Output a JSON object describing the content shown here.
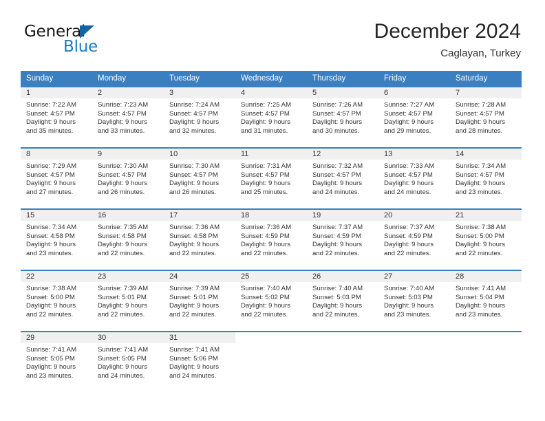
{
  "brand": {
    "name_primary": "General",
    "name_secondary": "Blue",
    "triangle_color": "#1464a5",
    "secondary_color": "#1d7ac4"
  },
  "header": {
    "month_title": "December 2024",
    "location": "Caglayan, Turkey"
  },
  "theme": {
    "header_blue": "#3a7fc1",
    "daynum_band": "#f0f0f0",
    "text": "#333333"
  },
  "calendar": {
    "weekday_headers": [
      "Sunday",
      "Monday",
      "Tuesday",
      "Wednesday",
      "Thursday",
      "Friday",
      "Saturday"
    ],
    "weeks": [
      [
        {
          "day": "1",
          "sunrise": "Sunrise: 7:22 AM",
          "sunset": "Sunset: 4:57 PM",
          "daylight_1": "Daylight: 9 hours",
          "daylight_2": "and 35 minutes."
        },
        {
          "day": "2",
          "sunrise": "Sunrise: 7:23 AM",
          "sunset": "Sunset: 4:57 PM",
          "daylight_1": "Daylight: 9 hours",
          "daylight_2": "and 33 minutes."
        },
        {
          "day": "3",
          "sunrise": "Sunrise: 7:24 AM",
          "sunset": "Sunset: 4:57 PM",
          "daylight_1": "Daylight: 9 hours",
          "daylight_2": "and 32 minutes."
        },
        {
          "day": "4",
          "sunrise": "Sunrise: 7:25 AM",
          "sunset": "Sunset: 4:57 PM",
          "daylight_1": "Daylight: 9 hours",
          "daylight_2": "and 31 minutes."
        },
        {
          "day": "5",
          "sunrise": "Sunrise: 7:26 AM",
          "sunset": "Sunset: 4:57 PM",
          "daylight_1": "Daylight: 9 hours",
          "daylight_2": "and 30 minutes."
        },
        {
          "day": "6",
          "sunrise": "Sunrise: 7:27 AM",
          "sunset": "Sunset: 4:57 PM",
          "daylight_1": "Daylight: 9 hours",
          "daylight_2": "and 29 minutes."
        },
        {
          "day": "7",
          "sunrise": "Sunrise: 7:28 AM",
          "sunset": "Sunset: 4:57 PM",
          "daylight_1": "Daylight: 9 hours",
          "daylight_2": "and 28 minutes."
        }
      ],
      [
        {
          "day": "8",
          "sunrise": "Sunrise: 7:29 AM",
          "sunset": "Sunset: 4:57 PM",
          "daylight_1": "Daylight: 9 hours",
          "daylight_2": "and 27 minutes."
        },
        {
          "day": "9",
          "sunrise": "Sunrise: 7:30 AM",
          "sunset": "Sunset: 4:57 PM",
          "daylight_1": "Daylight: 9 hours",
          "daylight_2": "and 26 minutes."
        },
        {
          "day": "10",
          "sunrise": "Sunrise: 7:30 AM",
          "sunset": "Sunset: 4:57 PM",
          "daylight_1": "Daylight: 9 hours",
          "daylight_2": "and 26 minutes."
        },
        {
          "day": "11",
          "sunrise": "Sunrise: 7:31 AM",
          "sunset": "Sunset: 4:57 PM",
          "daylight_1": "Daylight: 9 hours",
          "daylight_2": "and 25 minutes."
        },
        {
          "day": "12",
          "sunrise": "Sunrise: 7:32 AM",
          "sunset": "Sunset: 4:57 PM",
          "daylight_1": "Daylight: 9 hours",
          "daylight_2": "and 24 minutes."
        },
        {
          "day": "13",
          "sunrise": "Sunrise: 7:33 AM",
          "sunset": "Sunset: 4:57 PM",
          "daylight_1": "Daylight: 9 hours",
          "daylight_2": "and 24 minutes."
        },
        {
          "day": "14",
          "sunrise": "Sunrise: 7:34 AM",
          "sunset": "Sunset: 4:57 PM",
          "daylight_1": "Daylight: 9 hours",
          "daylight_2": "and 23 minutes."
        }
      ],
      [
        {
          "day": "15",
          "sunrise": "Sunrise: 7:34 AM",
          "sunset": "Sunset: 4:58 PM",
          "daylight_1": "Daylight: 9 hours",
          "daylight_2": "and 23 minutes."
        },
        {
          "day": "16",
          "sunrise": "Sunrise: 7:35 AM",
          "sunset": "Sunset: 4:58 PM",
          "daylight_1": "Daylight: 9 hours",
          "daylight_2": "and 22 minutes."
        },
        {
          "day": "17",
          "sunrise": "Sunrise: 7:36 AM",
          "sunset": "Sunset: 4:58 PM",
          "daylight_1": "Daylight: 9 hours",
          "daylight_2": "and 22 minutes."
        },
        {
          "day": "18",
          "sunrise": "Sunrise: 7:36 AM",
          "sunset": "Sunset: 4:59 PM",
          "daylight_1": "Daylight: 9 hours",
          "daylight_2": "and 22 minutes."
        },
        {
          "day": "19",
          "sunrise": "Sunrise: 7:37 AM",
          "sunset": "Sunset: 4:59 PM",
          "daylight_1": "Daylight: 9 hours",
          "daylight_2": "and 22 minutes."
        },
        {
          "day": "20",
          "sunrise": "Sunrise: 7:37 AM",
          "sunset": "Sunset: 4:59 PM",
          "daylight_1": "Daylight: 9 hours",
          "daylight_2": "and 22 minutes."
        },
        {
          "day": "21",
          "sunrise": "Sunrise: 7:38 AM",
          "sunset": "Sunset: 5:00 PM",
          "daylight_1": "Daylight: 9 hours",
          "daylight_2": "and 22 minutes."
        }
      ],
      [
        {
          "day": "22",
          "sunrise": "Sunrise: 7:38 AM",
          "sunset": "Sunset: 5:00 PM",
          "daylight_1": "Daylight: 9 hours",
          "daylight_2": "and 22 minutes."
        },
        {
          "day": "23",
          "sunrise": "Sunrise: 7:39 AM",
          "sunset": "Sunset: 5:01 PM",
          "daylight_1": "Daylight: 9 hours",
          "daylight_2": "and 22 minutes."
        },
        {
          "day": "24",
          "sunrise": "Sunrise: 7:39 AM",
          "sunset": "Sunset: 5:01 PM",
          "daylight_1": "Daylight: 9 hours",
          "daylight_2": "and 22 minutes."
        },
        {
          "day": "25",
          "sunrise": "Sunrise: 7:40 AM",
          "sunset": "Sunset: 5:02 PM",
          "daylight_1": "Daylight: 9 hours",
          "daylight_2": "and 22 minutes."
        },
        {
          "day": "26",
          "sunrise": "Sunrise: 7:40 AM",
          "sunset": "Sunset: 5:03 PM",
          "daylight_1": "Daylight: 9 hours",
          "daylight_2": "and 22 minutes."
        },
        {
          "day": "27",
          "sunrise": "Sunrise: 7:40 AM",
          "sunset": "Sunset: 5:03 PM",
          "daylight_1": "Daylight: 9 hours",
          "daylight_2": "and 23 minutes."
        },
        {
          "day": "28",
          "sunrise": "Sunrise: 7:41 AM",
          "sunset": "Sunset: 5:04 PM",
          "daylight_1": "Daylight: 9 hours",
          "daylight_2": "and 23 minutes."
        }
      ],
      [
        {
          "day": "29",
          "sunrise": "Sunrise: 7:41 AM",
          "sunset": "Sunset: 5:05 PM",
          "daylight_1": "Daylight: 9 hours",
          "daylight_2": "and 23 minutes."
        },
        {
          "day": "30",
          "sunrise": "Sunrise: 7:41 AM",
          "sunset": "Sunset: 5:05 PM",
          "daylight_1": "Daylight: 9 hours",
          "daylight_2": "and 24 minutes."
        },
        {
          "day": "31",
          "sunrise": "Sunrise: 7:41 AM",
          "sunset": "Sunset: 5:06 PM",
          "daylight_1": "Daylight: 9 hours",
          "daylight_2": "and 24 minutes."
        },
        {
          "day": "",
          "sunrise": "",
          "sunset": "",
          "daylight_1": "",
          "daylight_2": ""
        },
        {
          "day": "",
          "sunrise": "",
          "sunset": "",
          "daylight_1": "",
          "daylight_2": ""
        },
        {
          "day": "",
          "sunrise": "",
          "sunset": "",
          "daylight_1": "",
          "daylight_2": ""
        },
        {
          "day": "",
          "sunrise": "",
          "sunset": "",
          "daylight_1": "",
          "daylight_2": ""
        }
      ]
    ]
  }
}
